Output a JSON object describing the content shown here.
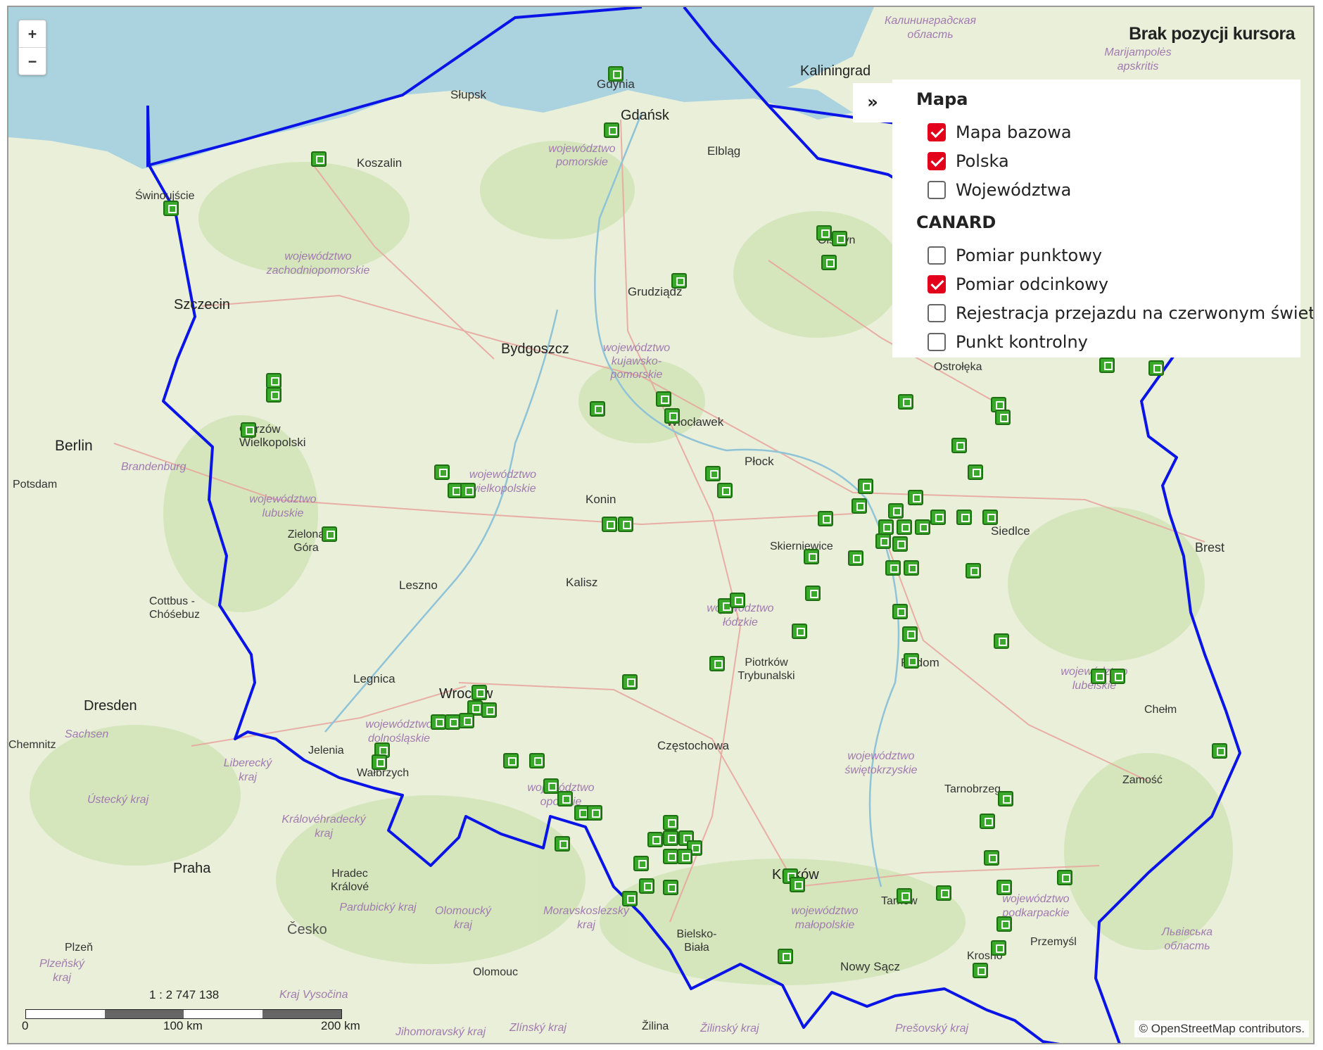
{
  "map": {
    "cursor_status": "Brak pozycji kursora",
    "zoom": {
      "in_label": "+",
      "out_label": "−"
    },
    "panel_toggle_label": "»",
    "scale": {
      "ratio": "1 : 2 747 138",
      "ticks": [
        "0",
        "100 km",
        "200 km"
      ]
    },
    "attribution": "© OpenStreetMap contributors.",
    "colors": {
      "water": "#aad3df",
      "land": "#e9efd9",
      "border": "#0a14e6",
      "marker": "#3aa82a",
      "checkbox_on": "#e3001b"
    },
    "marker_icon": "speed-camera-icon"
  },
  "layers": {
    "groups": [
      {
        "title": "Mapa",
        "items": [
          {
            "label": "Mapa bazowa",
            "checked": true
          },
          {
            "label": "Polska",
            "checked": true
          },
          {
            "label": "Województwa",
            "checked": false
          }
        ]
      },
      {
        "title": "CANARD",
        "items": [
          {
            "label": "Pomiar punktowy",
            "checked": false
          },
          {
            "label": "Pomiar odcinkowy",
            "checked": true
          },
          {
            "label": "Rejestracja przejazdu na czerwonym świetle",
            "checked": false
          },
          {
            "label": "Punkt kontrolny",
            "checked": false
          }
        ]
      }
    ]
  },
  "places": {
    "cities": [
      "Gdynia",
      "Gdańsk",
      "Słupsk",
      "Koszalin",
      "Elbląg",
      "Świnoujście",
      "Szczecin",
      "Grudziądz",
      "Bydgoszcz",
      "Włocławek",
      "Płock",
      "Gorzów Wielkopolski",
      "Berlin",
      "Potsdam",
      "Konin",
      "Zielona Góra",
      "Leszno",
      "Kalisz",
      "Skierniewice",
      "Cottbus - Chóśebuz",
      "Legnica",
      "Wrocław",
      "Dresden",
      "Jelenia",
      "Wałbrzych",
      "Piotrków Trybunalski",
      "Częstochowa",
      "Radom",
      "Siedlce",
      "Ostrołęka",
      "Olsztyn",
      "Kaliningrad",
      "Chełm",
      "Zamość",
      "Tarnobrzeg",
      "Kraków",
      "Tarnów",
      "Bielsko-Biała",
      "Nowy Sącz",
      "Krosno",
      "Przemyśl",
      "Praha",
      "Hradec Králové",
      "Olomouc",
      "Plzeň",
      "Žilina",
      "Chemnitz",
      "Brest"
    ],
    "regions": [
      "województwo pomorskie",
      "województwo zachodniopomorskie",
      "województwo kujawsko-pomorskie",
      "województwo wielkopolskie",
      "województwo lubuskie",
      "województwo łódzkie",
      "województwo dolnośląskie",
      "województwo opolskie",
      "województwo świętokrzyskie",
      "województwo małopolskie",
      "województwo podkarpackie",
      "województwo lubelskie",
      "Brandenburg",
      "Sachsen",
      "Liberecký kraj",
      "Ústecký kraj",
      "Královéhradecký kraj",
      "Pardubický kraj",
      "Olomoucký kraj",
      "Moravskoslezský kraj",
      "Česko",
      "Plzeňský kraj",
      "Kraj Vysočina",
      "Jihomoravský kraj",
      "Zlínský kraj",
      "Žilinský kraj",
      "Prešovský kraj",
      "Калининградская область",
      "Marijampolės apskritis",
      "Львівська область"
    ]
  }
}
